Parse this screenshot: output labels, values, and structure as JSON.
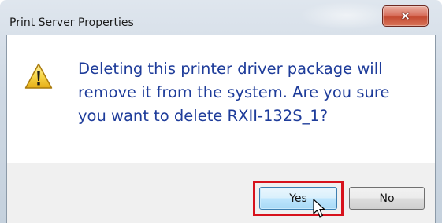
{
  "window": {
    "title": "Print Server Properties",
    "close_icon": "×"
  },
  "message": {
    "icon": "warning-icon",
    "text": "Deleting this printer driver package will\nremove it from the system. Are you sure\nyou want to delete RXII-132S_1?"
  },
  "buttons": {
    "yes_label": "Yes",
    "no_label": "No",
    "highlighted": "Yes"
  },
  "colors": {
    "message_text": "#1e3c9a",
    "highlight_border": "#d7121c",
    "close_button": "#c44a32",
    "button_panel": "#f0f0f0"
  }
}
